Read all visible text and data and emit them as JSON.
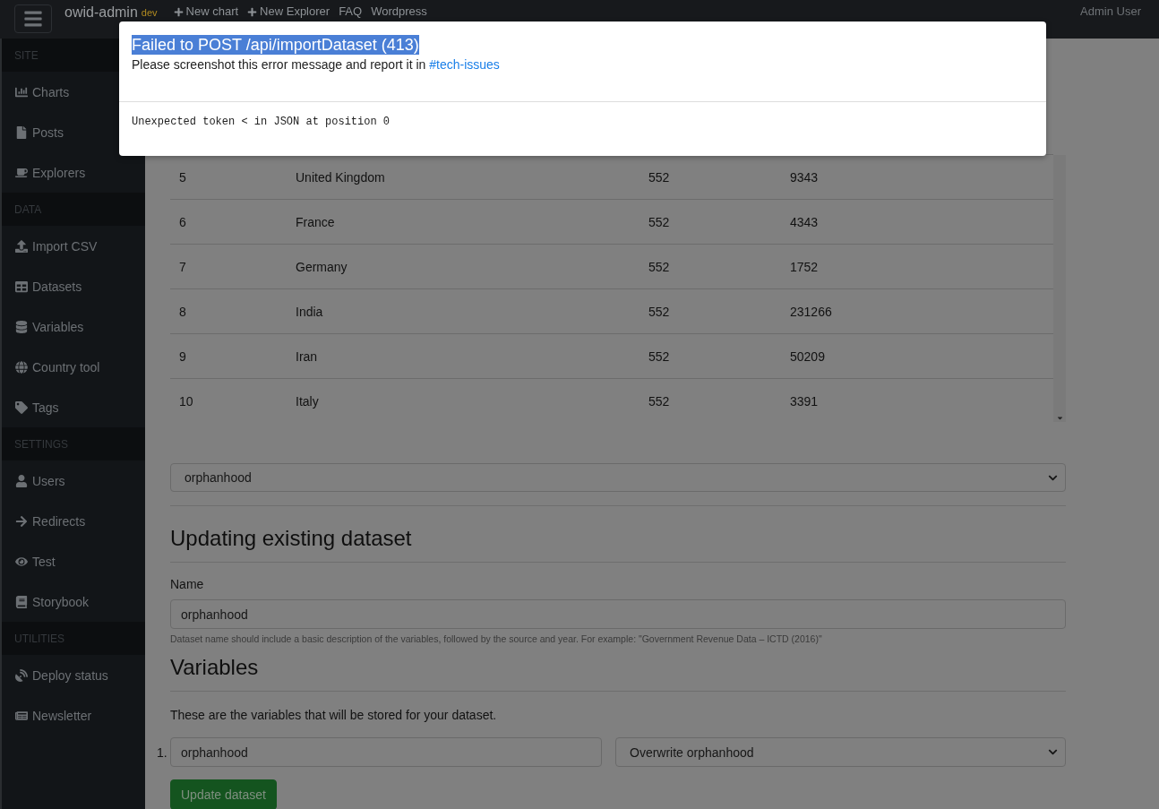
{
  "navbar": {
    "brand": "owid-admin",
    "env_badge": "dev",
    "links": [
      {
        "label": "New chart",
        "plus": true
      },
      {
        "label": "New Explorer",
        "plus": true
      },
      {
        "label": "FAQ",
        "plus": false
      },
      {
        "label": "Wordpress",
        "plus": false
      }
    ],
    "user": "Admin User"
  },
  "sidebar": {
    "sections": [
      {
        "heading": "SITE",
        "items": [
          "Charts",
          "Posts",
          "Explorers"
        ]
      },
      {
        "heading": "DATA",
        "items": [
          "Import CSV",
          "Datasets",
          "Variables",
          "Country tool",
          "Tags"
        ]
      },
      {
        "heading": "SETTINGS",
        "items": [
          "Users",
          "Redirects",
          "Test",
          "Storybook"
        ]
      },
      {
        "heading": "UTILITIES",
        "items": [
          "Deploy status",
          "Newsletter"
        ]
      }
    ]
  },
  "table": {
    "rows": [
      [
        "5",
        "United Kingdom",
        "552",
        "9343"
      ],
      [
        "6",
        "France",
        "552",
        "4343"
      ],
      [
        "7",
        "Germany",
        "552",
        "1752"
      ],
      [
        "8",
        "India",
        "552",
        "231266"
      ],
      [
        "9",
        "Iran",
        "552",
        "50209"
      ],
      [
        "10",
        "Italy",
        "552",
        "3391"
      ]
    ]
  },
  "dataset_select": "orphanhood",
  "update_section": {
    "heading": "Updating existing dataset",
    "name_label": "Name",
    "name_value": "orphanhood",
    "help": "Dataset name should include a basic description of the variables, followed by the source and year. For example: \"Government Revenue Data – ICTD (2016)\""
  },
  "variables_section": {
    "heading": "Variables",
    "intro": "These are the variables that will be stored for your dataset.",
    "variables": [
      {
        "number": "1.",
        "name": "orphanhood",
        "action": "Overwrite orphanhood"
      }
    ],
    "submit": "Update dataset"
  },
  "error_modal": {
    "title": "Failed to POST /api/importDataset (413)",
    "title_highlighted": true,
    "message": "Please screenshot this error message and report it in",
    "link": "#tech-issues",
    "details": "Unexpected token < in JSON at position 0"
  }
}
